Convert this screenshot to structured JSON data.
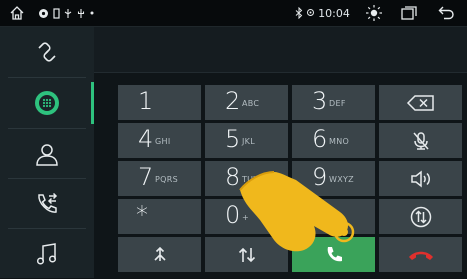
{
  "status_bar": {
    "time": "10:04",
    "icons": [
      "home-icon",
      "location-icon",
      "sim-icon",
      "usb-icon",
      "dot-icon",
      "bluetooth-icon",
      "location-pin-icon",
      "brightness-icon",
      "window-icon",
      "back-icon"
    ]
  },
  "sidebar": {
    "items": [
      {
        "name": "link",
        "icon": "link-icon",
        "active": false
      },
      {
        "name": "dialpad",
        "icon": "dialpad-icon",
        "active": true
      },
      {
        "name": "contacts",
        "icon": "contact-icon",
        "active": false
      },
      {
        "name": "call-log",
        "icon": "call-log-icon",
        "active": false
      },
      {
        "name": "music",
        "icon": "music-icon",
        "active": false
      }
    ]
  },
  "colors": {
    "accent": "#2ec27e",
    "key_bg": "#3a4449",
    "call_green": "#3aa35a",
    "end_red": "#e0302d"
  },
  "dialpad": {
    "keys": [
      {
        "digit": "1",
        "letters": ""
      },
      {
        "digit": "2",
        "letters": "ABC"
      },
      {
        "digit": "3",
        "letters": "DEF"
      },
      {
        "digit": "4",
        "letters": "GHI"
      },
      {
        "digit": "5",
        "letters": "JKL"
      },
      {
        "digit": "6",
        "letters": "MNO"
      },
      {
        "digit": "7",
        "letters": "PQRS"
      },
      {
        "digit": "8",
        "letters": "TUV"
      },
      {
        "digit": "9",
        "letters": "WXYZ"
      },
      {
        "digit": "*",
        "letters": ""
      },
      {
        "digit": "0",
        "letters": "+"
      }
    ],
    "side_actions": [
      "backspace-icon",
      "mic-mute-icon",
      "speaker-icon",
      "transfer-icon"
    ],
    "bottom_actions": [
      "merge-call-icon",
      "swap-call-icon",
      "call-icon",
      "end-call-icon"
    ]
  }
}
